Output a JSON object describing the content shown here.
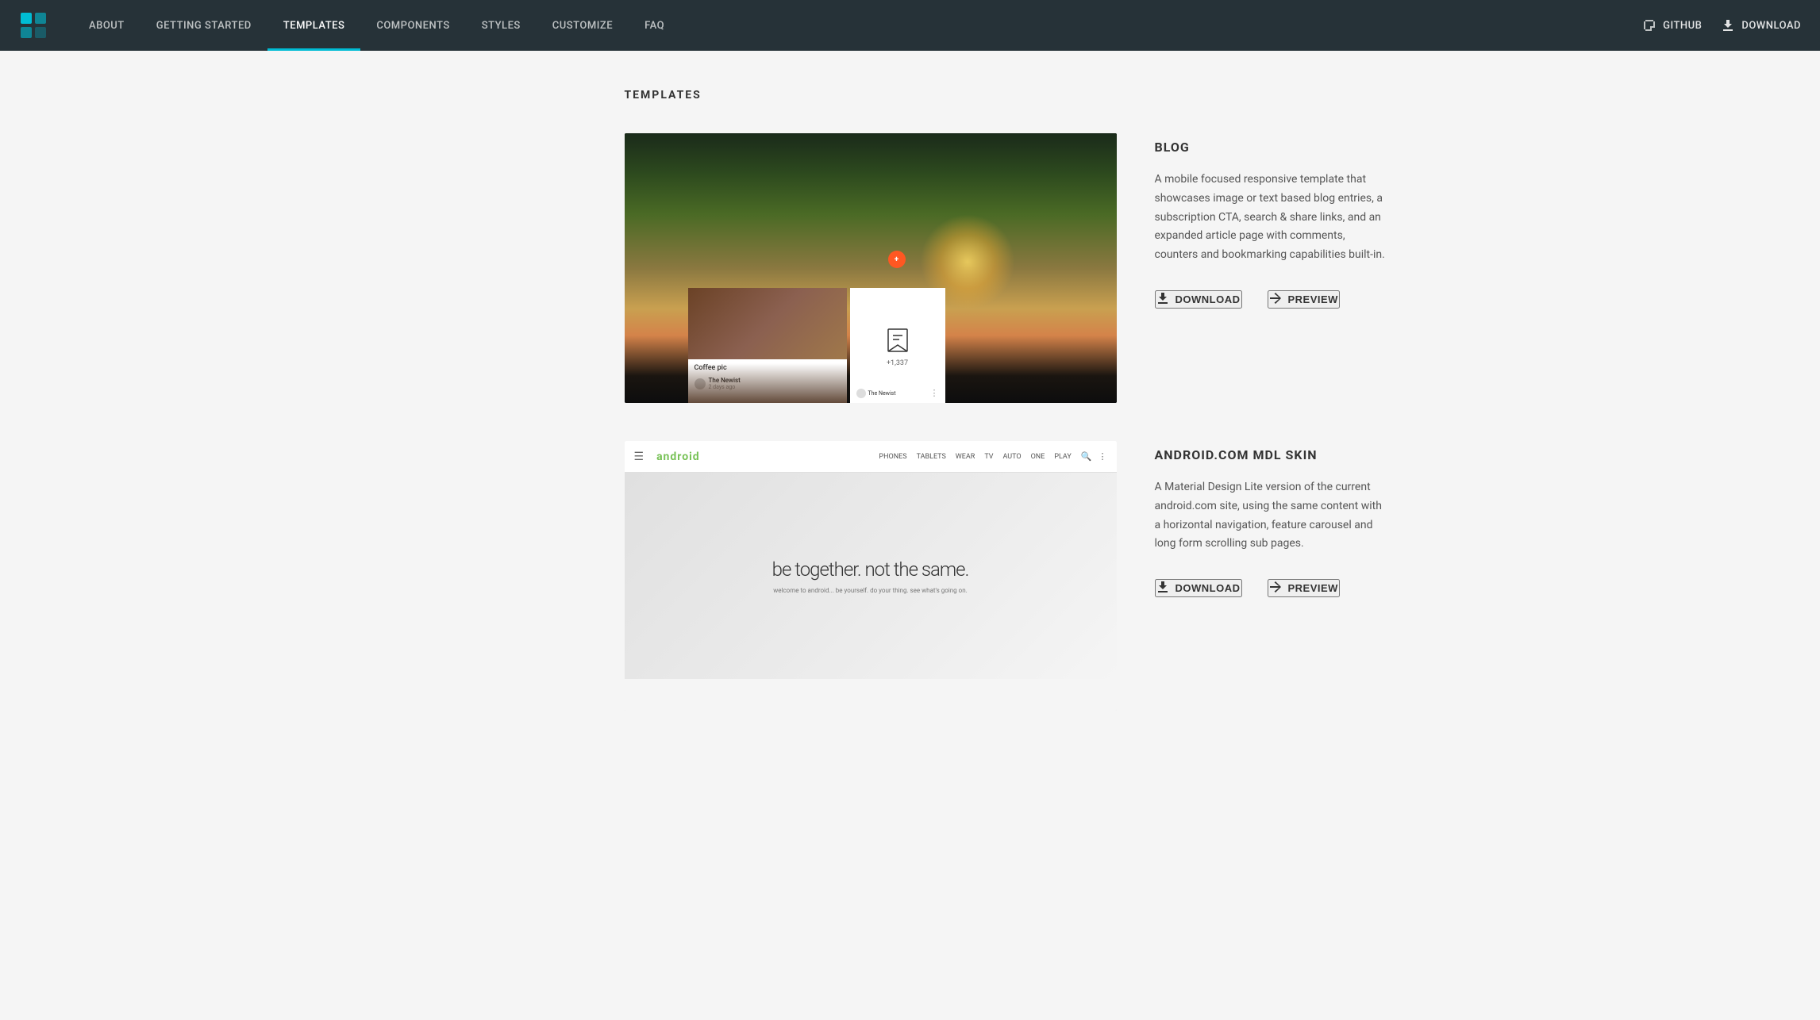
{
  "navbar": {
    "logo_alt": "MDL Logo",
    "items": [
      {
        "id": "about",
        "label": "ABOUT",
        "active": false
      },
      {
        "id": "getting-started",
        "label": "GETTING STARTED",
        "active": false
      },
      {
        "id": "templates",
        "label": "TEMPLATES",
        "active": true
      },
      {
        "id": "components",
        "label": "COMPONENTS",
        "active": false
      },
      {
        "id": "styles",
        "label": "STYLES",
        "active": false
      },
      {
        "id": "customize",
        "label": "CUSTOMIZE",
        "active": false
      },
      {
        "id": "faq",
        "label": "FAQ",
        "active": false
      }
    ],
    "github_label": "GitHub",
    "download_label": "Download"
  },
  "page": {
    "title": "TEMPLATES"
  },
  "templates": [
    {
      "id": "blog",
      "name": "BLOG",
      "description": "A mobile focused responsive template that showcases image or text based blog entries, a subscription CTA, search & share links, and an expanded article page with comments, counters and bookmarking capabilities built-in.",
      "download_label": "Download",
      "preview_label": "Preview",
      "preview_card_label": "Coffee pic",
      "preview_card_time": "2 days ago",
      "preview_card_author": "The Newist",
      "preview_card_count": "+1,337",
      "preview_badge": "+"
    },
    {
      "id": "android-mdl",
      "name": "ANDROID.COM MDL SKIN",
      "description": "A Material Design Lite version of the current android.com site, using the same content with a horizontal navigation, feature carousel and long form scrolling sub pages.",
      "download_label": "Download",
      "preview_label": "Preview",
      "android_logo": "android",
      "android_nav_items": [
        "PHONES",
        "TABLETS",
        "WEAR",
        "TV",
        "AUTO",
        "ONE",
        "PLAY"
      ],
      "android_hero_title": "be together. not the same.",
      "android_hero_subtitle": "welcome to android... be yourself. do your thing. see what's going on."
    }
  ]
}
